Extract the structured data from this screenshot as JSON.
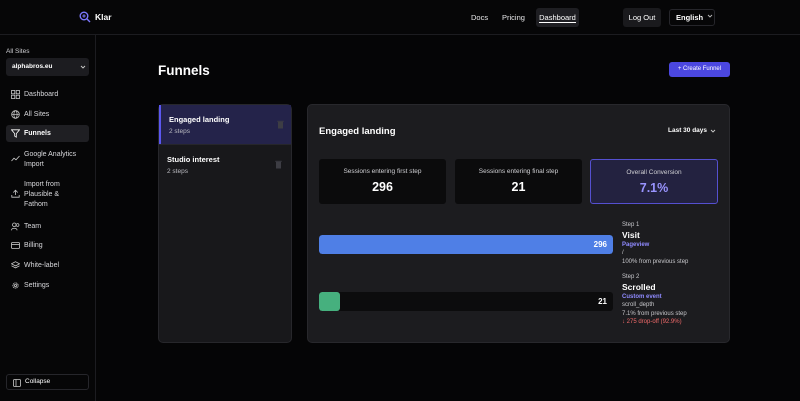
{
  "header": {
    "brand": "Klar",
    "nav": [
      "Docs",
      "Pricing",
      "Dashboard"
    ],
    "logout": "Log Out",
    "language": "English"
  },
  "sidebar": {
    "site_label": "All Sites",
    "selected_site": "alphabros.eu",
    "items": [
      {
        "label": "Dashboard",
        "icon": "dashboard-icon"
      },
      {
        "label": "All Sites",
        "icon": "globe-icon"
      },
      {
        "label": "Funnels",
        "icon": "funnel-icon"
      },
      {
        "label": "Google Analytics Import",
        "icon": "trend-icon"
      },
      {
        "label": "Import from Plausible & Fathom",
        "icon": "upload-icon"
      },
      {
        "label": "Team",
        "icon": "users-icon"
      },
      {
        "label": "Billing",
        "icon": "card-icon"
      },
      {
        "label": "White-label",
        "icon": "layers-icon"
      },
      {
        "label": "Settings",
        "icon": "gear-icon"
      }
    ],
    "collapse": "Collapse"
  },
  "main": {
    "title": "Funnels",
    "create_button": "+ Create Funnel",
    "funnels": [
      {
        "name": "Engaged landing",
        "steps": "2 steps"
      },
      {
        "name": "Studio interest",
        "steps": "2 steps"
      }
    ],
    "detail": {
      "title": "Engaged landing",
      "range": "Last 30 days",
      "stats": [
        {
          "label": "Sessions entering first step",
          "value": "296"
        },
        {
          "label": "Sessions entering final step",
          "value": "21"
        },
        {
          "label": "Overall Conversion",
          "value": "7.1%"
        }
      ],
      "steps": [
        {
          "step": "Step 1",
          "name": "Visit",
          "type": "Pageview",
          "target": "/",
          "pct": "100% from previous step",
          "drop": "",
          "value": "296",
          "fraction": 1.0
        },
        {
          "step": "Step 2",
          "name": "Scrolled",
          "type": "Custom event",
          "target": "scroll_depth",
          "pct": "7.1% from previous step",
          "drop": "↓ 275 drop-off (92.9%)",
          "value": "21",
          "fraction": 0.071
        }
      ]
    }
  },
  "colors": {
    "accent": "#4b47e0",
    "bar1": "#4f7fe6",
    "bar2": "#46b07e",
    "dropoff": "#f06a6a"
  }
}
